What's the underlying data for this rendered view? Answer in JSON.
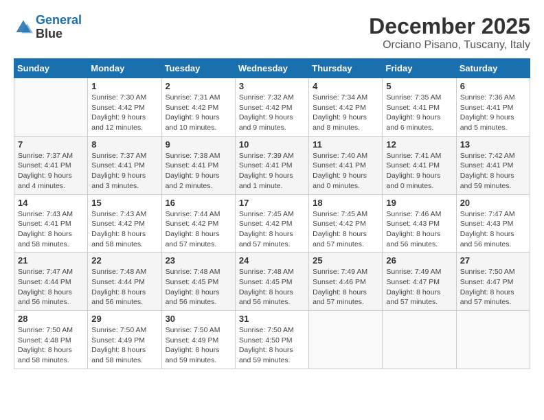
{
  "logo": {
    "line1": "General",
    "line2": "Blue"
  },
  "title": "December 2025",
  "location": "Orciano Pisano, Tuscany, Italy",
  "days_of_week": [
    "Sunday",
    "Monday",
    "Tuesday",
    "Wednesday",
    "Thursday",
    "Friday",
    "Saturday"
  ],
  "weeks": [
    [
      {
        "day": "",
        "info": ""
      },
      {
        "day": "1",
        "info": "Sunrise: 7:30 AM\nSunset: 4:42 PM\nDaylight: 9 hours\nand 12 minutes."
      },
      {
        "day": "2",
        "info": "Sunrise: 7:31 AM\nSunset: 4:42 PM\nDaylight: 9 hours\nand 10 minutes."
      },
      {
        "day": "3",
        "info": "Sunrise: 7:32 AM\nSunset: 4:42 PM\nDaylight: 9 hours\nand 9 minutes."
      },
      {
        "day": "4",
        "info": "Sunrise: 7:34 AM\nSunset: 4:42 PM\nDaylight: 9 hours\nand 8 minutes."
      },
      {
        "day": "5",
        "info": "Sunrise: 7:35 AM\nSunset: 4:41 PM\nDaylight: 9 hours\nand 6 minutes."
      },
      {
        "day": "6",
        "info": "Sunrise: 7:36 AM\nSunset: 4:41 PM\nDaylight: 9 hours\nand 5 minutes."
      }
    ],
    [
      {
        "day": "7",
        "info": "Sunrise: 7:37 AM\nSunset: 4:41 PM\nDaylight: 9 hours\nand 4 minutes."
      },
      {
        "day": "8",
        "info": "Sunrise: 7:37 AM\nSunset: 4:41 PM\nDaylight: 9 hours\nand 3 minutes."
      },
      {
        "day": "9",
        "info": "Sunrise: 7:38 AM\nSunset: 4:41 PM\nDaylight: 9 hours\nand 2 minutes."
      },
      {
        "day": "10",
        "info": "Sunrise: 7:39 AM\nSunset: 4:41 PM\nDaylight: 9 hours\nand 1 minute."
      },
      {
        "day": "11",
        "info": "Sunrise: 7:40 AM\nSunset: 4:41 PM\nDaylight: 9 hours\nand 0 minutes."
      },
      {
        "day": "12",
        "info": "Sunrise: 7:41 AM\nSunset: 4:41 PM\nDaylight: 9 hours\nand 0 minutes."
      },
      {
        "day": "13",
        "info": "Sunrise: 7:42 AM\nSunset: 4:41 PM\nDaylight: 8 hours\nand 59 minutes."
      }
    ],
    [
      {
        "day": "14",
        "info": "Sunrise: 7:43 AM\nSunset: 4:41 PM\nDaylight: 8 hours\nand 58 minutes."
      },
      {
        "day": "15",
        "info": "Sunrise: 7:43 AM\nSunset: 4:42 PM\nDaylight: 8 hours\nand 58 minutes."
      },
      {
        "day": "16",
        "info": "Sunrise: 7:44 AM\nSunset: 4:42 PM\nDaylight: 8 hours\nand 57 minutes."
      },
      {
        "day": "17",
        "info": "Sunrise: 7:45 AM\nSunset: 4:42 PM\nDaylight: 8 hours\nand 57 minutes."
      },
      {
        "day": "18",
        "info": "Sunrise: 7:45 AM\nSunset: 4:42 PM\nDaylight: 8 hours\nand 57 minutes."
      },
      {
        "day": "19",
        "info": "Sunrise: 7:46 AM\nSunset: 4:43 PM\nDaylight: 8 hours\nand 56 minutes."
      },
      {
        "day": "20",
        "info": "Sunrise: 7:47 AM\nSunset: 4:43 PM\nDaylight: 8 hours\nand 56 minutes."
      }
    ],
    [
      {
        "day": "21",
        "info": "Sunrise: 7:47 AM\nSunset: 4:44 PM\nDaylight: 8 hours\nand 56 minutes."
      },
      {
        "day": "22",
        "info": "Sunrise: 7:48 AM\nSunset: 4:44 PM\nDaylight: 8 hours\nand 56 minutes."
      },
      {
        "day": "23",
        "info": "Sunrise: 7:48 AM\nSunset: 4:45 PM\nDaylight: 8 hours\nand 56 minutes."
      },
      {
        "day": "24",
        "info": "Sunrise: 7:48 AM\nSunset: 4:45 PM\nDaylight: 8 hours\nand 56 minutes."
      },
      {
        "day": "25",
        "info": "Sunrise: 7:49 AM\nSunset: 4:46 PM\nDaylight: 8 hours\nand 57 minutes."
      },
      {
        "day": "26",
        "info": "Sunrise: 7:49 AM\nSunset: 4:47 PM\nDaylight: 8 hours\nand 57 minutes."
      },
      {
        "day": "27",
        "info": "Sunrise: 7:50 AM\nSunset: 4:47 PM\nDaylight: 8 hours\nand 57 minutes."
      }
    ],
    [
      {
        "day": "28",
        "info": "Sunrise: 7:50 AM\nSunset: 4:48 PM\nDaylight: 8 hours\nand 58 minutes."
      },
      {
        "day": "29",
        "info": "Sunrise: 7:50 AM\nSunset: 4:49 PM\nDaylight: 8 hours\nand 58 minutes."
      },
      {
        "day": "30",
        "info": "Sunrise: 7:50 AM\nSunset: 4:49 PM\nDaylight: 8 hours\nand 59 minutes."
      },
      {
        "day": "31",
        "info": "Sunrise: 7:50 AM\nSunset: 4:50 PM\nDaylight: 8 hours\nand 59 minutes."
      },
      {
        "day": "",
        "info": ""
      },
      {
        "day": "",
        "info": ""
      },
      {
        "day": "",
        "info": ""
      }
    ]
  ]
}
